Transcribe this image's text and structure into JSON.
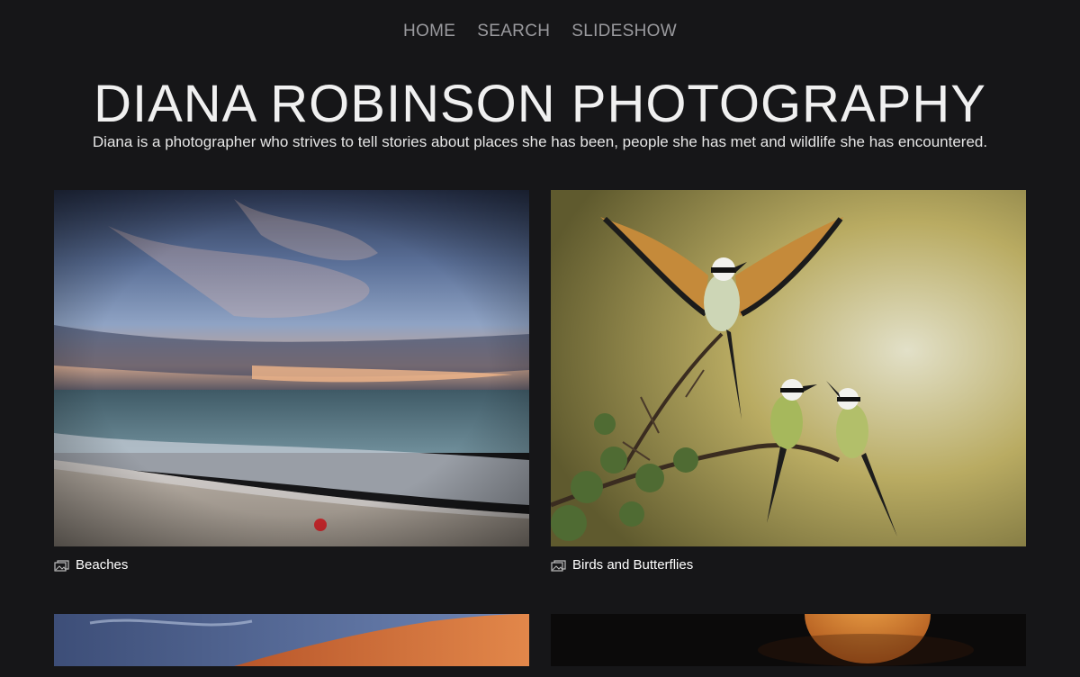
{
  "nav": {
    "items": [
      "HOME",
      "SEARCH",
      "SLIDESHOW"
    ]
  },
  "header": {
    "title": "DIANA ROBINSON PHOTOGRAPHY",
    "subtitle": "Diana is a photographer who strives to tell stories about places she has been, people she has met and wildlife she has encountered."
  },
  "galleries": [
    {
      "label": "Beaches",
      "icon": "album-icon"
    },
    {
      "label": "Birds and Butterflies",
      "icon": "album-icon"
    }
  ],
  "colors": {
    "background": "#161618",
    "nav": "#9a9a9e",
    "text": "#f0f0f0"
  }
}
